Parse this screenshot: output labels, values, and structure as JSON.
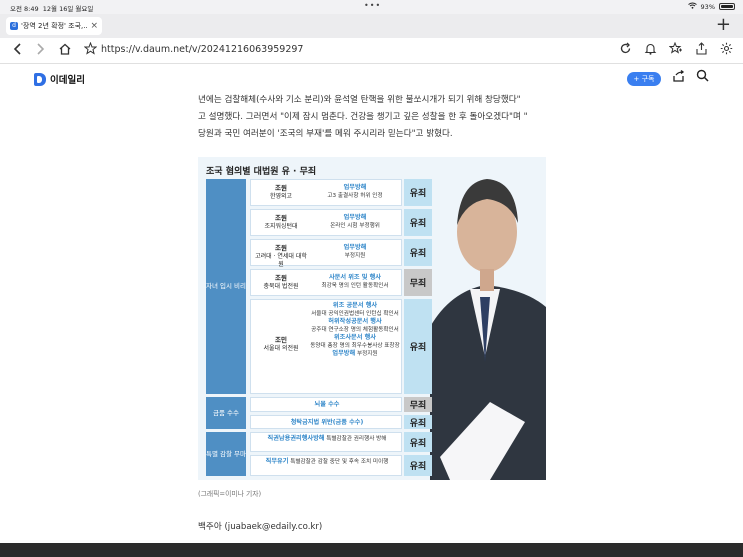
{
  "status": {
    "time": "오전 8:49",
    "date": "12월 16일 월요일",
    "battery": "93%"
  },
  "tab": {
    "title": "'장역 2년 확정' 조국,...",
    "new_tab": "+"
  },
  "address": {
    "url": "https://v.daum.net/v/20241216063959297"
  },
  "site": {
    "brand": "이데일리",
    "follow_label": "+ 구독"
  },
  "article": {
    "lines": [
      "년에는 검찰해체(수사와 기소 분리)와 윤석열 탄핵을 위한 불쏘시개가 되기 위해 창당했다\"",
      "고 설명했다. 그러면서 \"이제 잠시 멈춘다. 건강을 챙기고 깊은 성찰을 한 후 돌아오겠다\"며 \"",
      "당원과 국민 여러분이 '조국의 부재'를 메워 주시리라 믿는다\"고 밝혔다."
    ],
    "caption": "(그래픽=이미나 기자)",
    "byline": "백주아 (juabaek@edaily.co.kr)"
  },
  "graphic": {
    "title": "조국 혐의별 대법원 유 · 무죄",
    "categories": [
      {
        "label": "자녀 입시 비리"
      },
      {
        "label": "금품 수수"
      },
      {
        "label": "특별 감찰 무마"
      }
    ],
    "rows": [
      {
        "person": "조원",
        "person_sub": "한영외고",
        "charge": "업무방해",
        "detail": "고3 출결사항 허위 인정",
        "verdict": "유죄"
      },
      {
        "person": "조원",
        "person_sub": "조지워싱턴대",
        "charge": "업무방해",
        "detail": "온라인 시험 부정행위",
        "verdict": "유죄"
      },
      {
        "person": "조원",
        "person_sub": "고려대 · 연세대 대학원",
        "charge": "업무방해",
        "detail": "부정지원",
        "verdict": "유죄"
      },
      {
        "person": "조원",
        "person_sub": "충북대 법전원",
        "charge": "사문서 위조 및 행사",
        "detail": "최강욱 명의 인턴 활동확인서",
        "verdict": "무죄"
      },
      {
        "person": "조민",
        "person_sub": "서울대 의전원",
        "charge": "위조 공문서 행사",
        "detail": "서울대 공익인권법센터 인턴십 확인서",
        "charge2": "허위작성공문서 행사",
        "detail2": "공주대 연구소장 명의 체험활동확인서",
        "charge3": "위조사문서 행사",
        "detail3": "동양대 총장 명의 최우수봉사상 표창장",
        "charge4": "업무방해",
        "detail4": "부정지원",
        "verdict": "유죄"
      },
      {
        "person": "",
        "person_sub": "",
        "charge": "뇌물 수수",
        "detail": "",
        "verdict": "무죄"
      },
      {
        "person": "",
        "person_sub": "",
        "charge": "청탁금지법 위반(금품 수수)",
        "detail": "",
        "verdict": "유죄"
      },
      {
        "person": "",
        "person_sub": "",
        "charge": "직권남용권리행사방해",
        "detail": "특별감찰관 권리행사 방해",
        "verdict": "유죄"
      },
      {
        "person": "",
        "person_sub": "",
        "charge": "직무유기",
        "detail": "특별감찰관 감찰 중단 및 후속 조치 미이행",
        "verdict": "유죄"
      }
    ]
  },
  "colors": {
    "accent": "#3a7ff0",
    "category": "#4f8fc4",
    "guilty": "#bfe1f2",
    "acquit": "#c8c8c8"
  }
}
